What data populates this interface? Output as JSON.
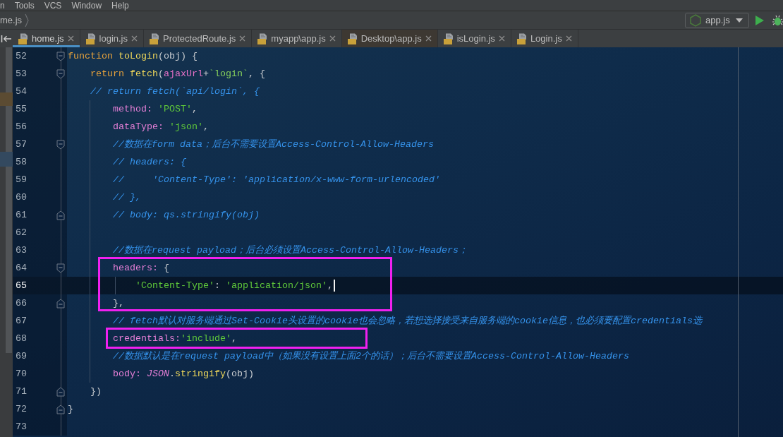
{
  "menu_bar": {
    "items": [
      "n",
      "Tools",
      "VCS",
      "Window",
      "Help"
    ]
  },
  "navigation_bar": {
    "breadcrumb": [
      "me.js"
    ],
    "run_configuration": "app.js"
  },
  "tabs": [
    {
      "label": "home.js",
      "selected": true,
      "color": "#3c3f41"
    },
    {
      "label": "login.js",
      "selected": false,
      "color": "#3c3f41"
    },
    {
      "label": "ProtectedRoute.js",
      "selected": false,
      "color": "#3c3f41"
    },
    {
      "label": "myapp\\app.js",
      "selected": false,
      "color": "#3c3f41"
    },
    {
      "label": "Desktop\\app.js",
      "selected": false,
      "color": "#3d3832"
    },
    {
      "label": "isLogin.js",
      "selected": false,
      "color": "#3c3f41"
    },
    {
      "label": "Login.js",
      "selected": false,
      "color": "#3c3f41"
    }
  ],
  "editor": {
    "lines": [
      {
        "number": "52",
        "kind": "start",
        "current": false,
        "tokens": [
          {
            "kind": "keyword",
            "text": "function "
          },
          {
            "kind": "function",
            "text": "toLogin"
          },
          {
            "kind": "plain",
            "text": "(obj) {"
          }
        ],
        "children": [
          {
            "number": "53",
            "kind": "start",
            "current": false,
            "tokens": [
              {
                "kind": "keyword",
                "text": "return "
              },
              {
                "kind": "function",
                "text": "fetch"
              },
              {
                "kind": "plain",
                "text": "("
              },
              {
                "kind": "variable",
                "text": "ajaxUrl"
              },
              {
                "kind": "plain",
                "text": "+"
              },
              {
                "kind": "template",
                "text": "`login`"
              },
              {
                "kind": "plain",
                "text": ", {"
              }
            ]
          },
          {
            "number": "54",
            "kind": "plain",
            "current": false,
            "tokens": [
              {
                "kind": "comment",
                "text": "// return fetch(`api/login`, {"
              }
            ],
            "children": [
              {
                "number": "55",
                "kind": "plain",
                "current": false,
                "tokens": [
                  {
                    "kind": "property",
                    "text": "method: "
                  },
                  {
                    "kind": "string",
                    "text": "'POST'"
                  },
                  {
                    "kind": "plain",
                    "text": ","
                  }
                ]
              },
              {
                "number": "56",
                "kind": "plain",
                "current": false,
                "tokens": [
                  {
                    "kind": "property",
                    "text": "dataType: "
                  },
                  {
                    "kind": "string",
                    "text": "'json'"
                  },
                  {
                    "kind": "plain",
                    "text": ","
                  }
                ]
              },
              {
                "number": "57",
                "kind": "start",
                "current": false,
                "tokens": [
                  {
                    "kind": "comment",
                    "text": "//数据在form data；后台不需要设置Access-Control-Allow-Headers"
                  }
                ]
              },
              {
                "number": "58",
                "kind": "plain",
                "current": false,
                "tokens": [
                  {
                    "kind": "comment",
                    "text": "// headers: {"
                  }
                ]
              },
              {
                "number": "59",
                "kind": "plain",
                "current": false,
                "tokens": [
                  {
                    "kind": "comment",
                    "text": "//     'Content-Type': 'application/x-www-form-urlencoded'"
                  }
                ]
              },
              {
                "number": "60",
                "kind": "plain",
                "current": false,
                "tokens": [
                  {
                    "kind": "comment",
                    "text": "// },"
                  }
                ]
              },
              {
                "number": "61",
                "kind": "end",
                "current": false,
                "tokens": [
                  {
                    "kind": "comment",
                    "text": "// body: qs.stringify(obj)"
                  }
                ]
              },
              {
                "number": "62",
                "kind": "plain",
                "current": false
              },
              {
                "number": "63",
                "kind": "plain",
                "current": false,
                "tokens": [
                  {
                    "kind": "comment",
                    "text": "//数据在request payload；后台必须设置Access-Control-Allow-Headers；"
                  }
                ]
              },
              {
                "number": "64",
                "kind": "start",
                "current": false,
                "tokens": [
                  {
                    "kind": "property",
                    "text": "headers:"
                  },
                  {
                    "kind": "plain",
                    "text": " {"
                  }
                ],
                "children": [
                  {
                    "number": "65",
                    "kind": "plain",
                    "current": true,
                    "tokens": [
                      {
                        "kind": "string",
                        "text": "'Content-Type'"
                      },
                      {
                        "kind": "plain",
                        "text": ": "
                      },
                      {
                        "kind": "string",
                        "text": "'application/json'"
                      },
                      {
                        "kind": "plain",
                        "text": ","
                      }
                    ]
                  }
                ]
              },
              {
                "number": "66",
                "kind": "end",
                "current": false,
                "tokens": [
                  {
                    "kind": "plain",
                    "text": "},"
                  }
                ]
              },
              {
                "number": "67",
                "kind": "plain",
                "current": false,
                "tokens": [
                  {
                    "kind": "comment",
                    "text": "// fetch默认对服务端通过Set-Cookie头设置的cookie也会忽略，若想选择接受来自服务端的cookie信息，也必须要配置credentials选"
                  }
                ]
              },
              {
                "number": "68",
                "kind": "plain",
                "current": false,
                "tokens": [
                  {
                    "kind": "property",
                    "text": "credentials:"
                  },
                  {
                    "kind": "string",
                    "text": "'include'"
                  },
                  {
                    "kind": "plain",
                    "text": ","
                  }
                ]
              },
              {
                "number": "69",
                "kind": "plain",
                "current": false,
                "tokens": [
                  {
                    "kind": "comment",
                    "text": "//数据默认是在request payload中（如果没有设置上面2个的话）；后台不需要设置Access-Control-Allow-Headers"
                  }
                ]
              },
              {
                "number": "70",
                "kind": "plain",
                "current": false,
                "tokens": [
                  {
                    "kind": "property",
                    "text": "body: "
                  },
                  {
                    "kind": "global",
                    "text": "JSON"
                  },
                  {
                    "kind": "plain",
                    "text": "."
                  },
                  {
                    "kind": "function",
                    "text": "stringify"
                  },
                  {
                    "kind": "plain",
                    "text": "(obj)"
                  }
                ]
              }
            ]
          },
          {
            "number": "71",
            "kind": "end",
            "current": false,
            "tokens": [
              {
                "kind": "plain",
                "text": "})"
              }
            ]
          }
        ]
      },
      {
        "number": "72",
        "kind": "end",
        "current": false,
        "tokens": [
          {
            "kind": "plain",
            "text": "}"
          }
        ]
      },
      {
        "number": "73",
        "kind": "plain",
        "current": false
      }
    ]
  }
}
